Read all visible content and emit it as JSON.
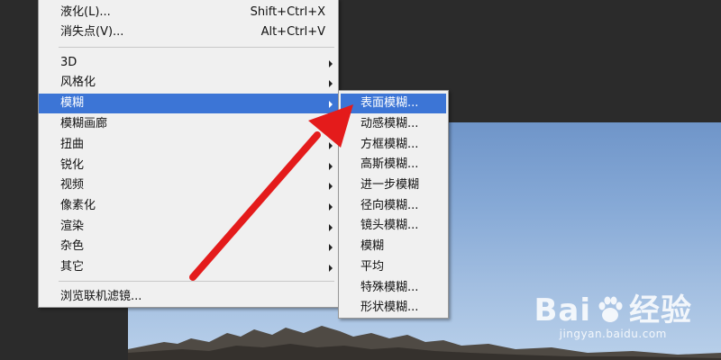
{
  "main_menu": {
    "items_top": [
      {
        "label": "液化(L)...",
        "shortcut": "Shift+Ctrl+X"
      },
      {
        "label": "消失点(V)...",
        "shortcut": "Alt+Ctrl+V"
      }
    ],
    "submenu_items": [
      {
        "label": "3D"
      },
      {
        "label": "风格化"
      },
      {
        "label": "模糊",
        "active": true
      },
      {
        "label": "模糊画廊"
      },
      {
        "label": "扭曲"
      },
      {
        "label": "锐化"
      },
      {
        "label": "视频"
      },
      {
        "label": "像素化"
      },
      {
        "label": "渲染"
      },
      {
        "label": "杂色"
      },
      {
        "label": "其它"
      }
    ],
    "browse": {
      "label": "浏览联机滤镜..."
    }
  },
  "blur_submenu": {
    "items": [
      {
        "label": "表面模糊...",
        "active": true
      },
      {
        "label": "动感模糊..."
      },
      {
        "label": "方框模糊..."
      },
      {
        "label": "高斯模糊..."
      },
      {
        "label": "进一步模糊"
      },
      {
        "label": "径向模糊..."
      },
      {
        "label": "镜头模糊..."
      },
      {
        "label": "模糊"
      },
      {
        "label": "平均"
      },
      {
        "label": "特殊模糊..."
      },
      {
        "label": "形状模糊..."
      }
    ]
  },
  "watermark": {
    "logo_text_a": "Bai",
    "logo_text_b": "经验",
    "url": "jingyan.baidu.com"
  },
  "colors": {
    "highlight": "#3c75d6",
    "annotation_arrow": "#e41b1b",
    "menu_bg": "#f0f0f0",
    "workspace_bg": "#2b2b2b"
  }
}
